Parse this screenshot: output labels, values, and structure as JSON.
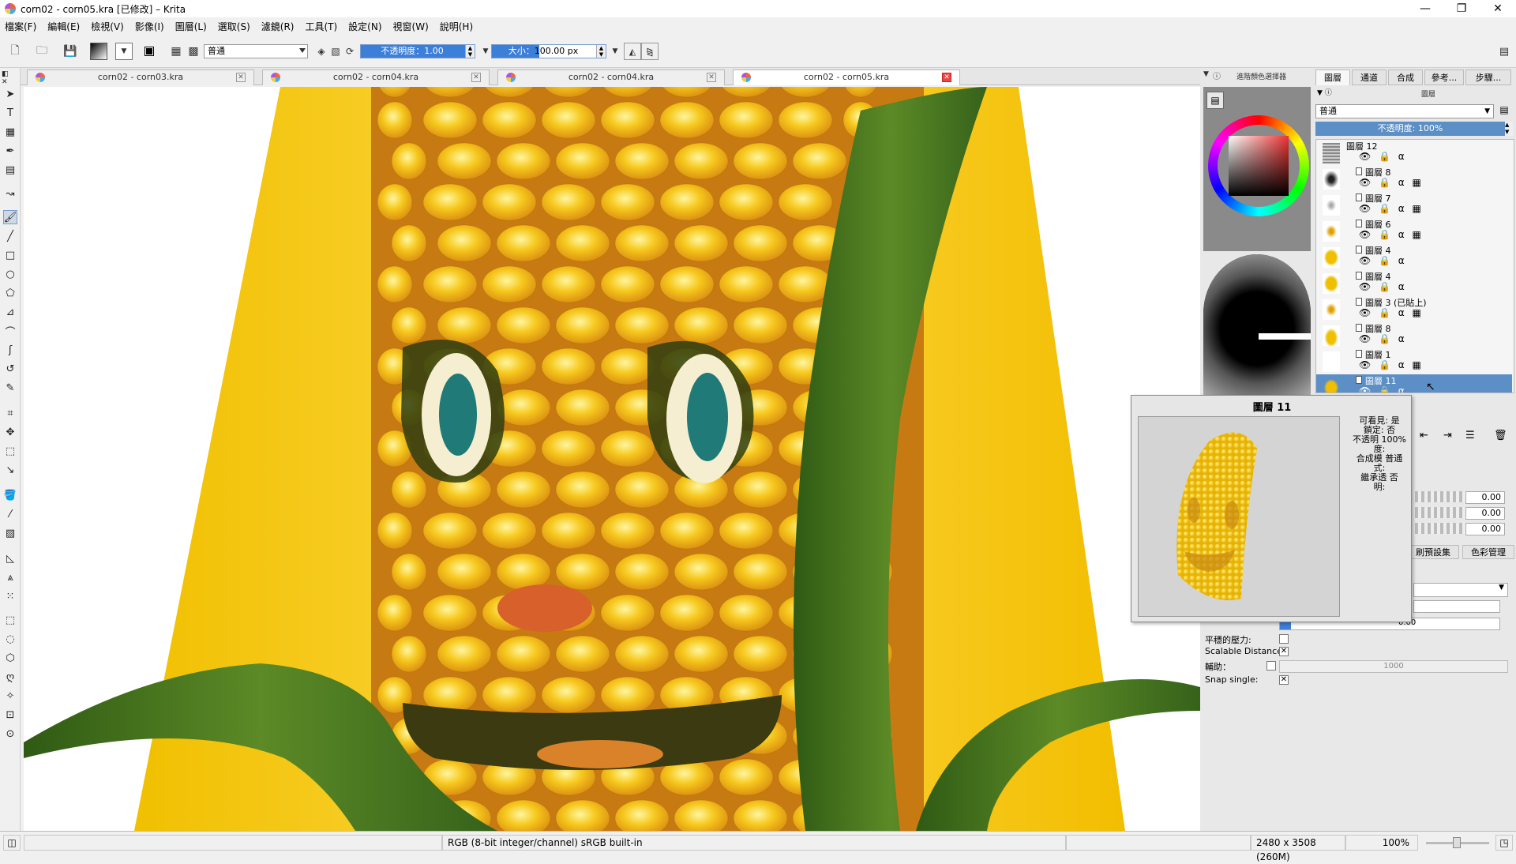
{
  "window": {
    "title": "corn02 - corn05.kra [已修改] – Krita",
    "controls": [
      "—",
      "❐",
      "✕"
    ]
  },
  "menu": [
    "檔案(F)",
    "編輯(E)",
    "檢視(V)",
    "影像(I)",
    "圖層(L)",
    "選取(S)",
    "濾鏡(R)",
    "工具(T)",
    "設定(N)",
    "視窗(W)",
    "說明(H)"
  ],
  "toolbar": {
    "blend_mode": "普通",
    "opacity_label": "不透明度：",
    "opacity_value": "1.00",
    "size_label": "大小：",
    "size_value": "100.00 px"
  },
  "tabs": [
    {
      "label": "corn02 - corn03.kra",
      "active": false
    },
    {
      "label": "corn02 - corn04.kra",
      "active": false
    },
    {
      "label": "corn02 - corn04.kra",
      "active": false
    },
    {
      "label": "corn02 - corn05.kra",
      "active": true
    }
  ],
  "right_panel": {
    "docker_title": "進階顏色選擇器",
    "tabs": [
      "圖層",
      "通道",
      "合成",
      "參考...",
      "步驟..."
    ],
    "layers_title": "圖層",
    "blend_mode": "普通",
    "opacity": "不透明度: 100%",
    "layers": [
      {
        "name": "圖層 12",
        "icons": "👁 🔒 α"
      },
      {
        "name": "圖層 8",
        "icons": "👁 🔒 α ▦"
      },
      {
        "name": "圖層 7",
        "icons": "👁 🔒 α ▦"
      },
      {
        "name": "圖層 6",
        "icons": "👁 🔒 α ▦"
      },
      {
        "name": "圖層 4",
        "icons": "👁 🔒 α"
      },
      {
        "name": "圖層 4",
        "icons": "👁 🔒 α"
      },
      {
        "name": "圖層 3 (已貼上)",
        "icons": "👁 🔒 α ▦"
      },
      {
        "name": "圖層 8",
        "icons": "👁 🔒 α"
      },
      {
        "name": "圖層 1",
        "icons": "👁 🔒 α ▦"
      },
      {
        "name": "圖層 11",
        "icons": "👁 🔒 α"
      }
    ],
    "values": [
      "0.00",
      "0.00",
      "0.00",
      "0.00"
    ],
    "sub_tabs": [
      "刷預設集",
      "色彩管理"
    ],
    "props": [
      {
        "label": "平穩的壓力:"
      },
      {
        "label": "Scalable Distance:"
      },
      {
        "label": "輔助："
      },
      {
        "label": "Snap single:"
      }
    ],
    "assist_value": "1000"
  },
  "tooltip": {
    "title": "圖層 11",
    "lines": [
      "可看見: 是",
      "鎖定: 否",
      "不透明 100%",
      "度:",
      "合成模 普通",
      "式:",
      "繼承透 否",
      "明:"
    ]
  },
  "status": {
    "color_space": "RGB (8-bit integer/channel)  sRGB built-in",
    "dimensions": "2480 x 3508 (260M)",
    "zoom": "100%"
  },
  "colors": {
    "accent": "#3c7fd8",
    "selection": "#5b8fc6",
    "corn": "#f2c21a",
    "husk": "#4f7a22"
  }
}
